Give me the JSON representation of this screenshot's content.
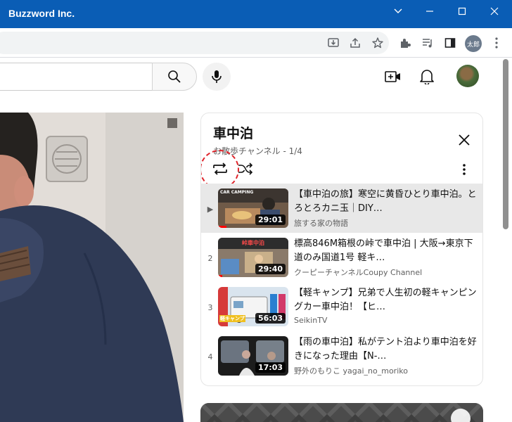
{
  "window": {
    "title": "Buzzword Inc.",
    "controls": [
      "chevron-down",
      "minimize",
      "maximize",
      "close"
    ]
  },
  "browser": {
    "profile_label": "太郎",
    "toolbar_icons": [
      "install-icon",
      "share-icon",
      "star-icon",
      "extensions-icon",
      "media-icon",
      "sidepanel-icon",
      "kebab-icon"
    ]
  },
  "header": {
    "icons": [
      "search-icon",
      "mic-icon",
      "create-video-icon",
      "bell-icon"
    ]
  },
  "playlist": {
    "title": "車中泊",
    "subtitle": "お散歩チャンネル - 1/4",
    "items": [
      {
        "index": "▶",
        "title": "【車中泊の旅】寒空に黄昏ひとり車中泊。とろとろカニ玉｜DIY…",
        "channel": "旅する家の物語",
        "duration": "29:01",
        "thumb_text": "CAR CAMPING"
      },
      {
        "index": "2",
        "title": "標高846M箱根の峠で車中泊 | 大阪→東京下道のみ国道1号 軽キ…",
        "channel": "クーピーチャンネルCoupy Channel",
        "duration": "29:40",
        "thumb_text": "峠車中泊"
      },
      {
        "index": "3",
        "title": "【軽キャンプ】兄弟で人生初の軽キャンピングカー車中泊！【ヒ…",
        "channel": "SeikinTV",
        "duration": "56:03",
        "thumb_text": "軽キャンプ"
      },
      {
        "index": "4",
        "title": "【雨の車中泊】私がテント泊より車中泊を好きになった理由【N-…",
        "channel": "野外のもりこ yagai_no_moriko",
        "duration": "17:03",
        "thumb_text": ""
      }
    ]
  },
  "colors": {
    "titlebar": "#0a5db5",
    "highlight": "#e0242b",
    "progress": "#ff0000"
  }
}
